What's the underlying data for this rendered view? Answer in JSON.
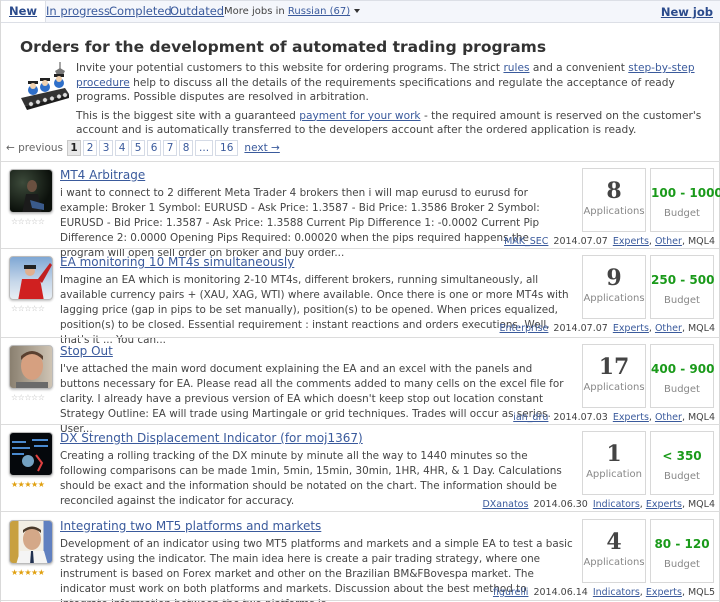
{
  "tabs": [
    {
      "label": "New",
      "active": true
    },
    {
      "label": "In progress",
      "active": false
    },
    {
      "label": "Completed",
      "active": false
    },
    {
      "label": "Outdated",
      "active": false
    }
  ],
  "more_jobs": {
    "prefix": "More jobs in ",
    "link": "Russian (67)"
  },
  "new_job_label": "New job",
  "intro": {
    "title": "Orders for the development of automated trading programs",
    "p1_a": "Invite your potential customers to this website for ordering programs. The strict ",
    "p1_link1": "rules",
    "p1_b": " and a convenient ",
    "p1_link2": "step-by-step procedure",
    "p1_c": " help to discuss all the details of the requirements specifications and regulate the acceptance of ready programs. Possible disputes are resolved in arbitration.",
    "p2_a": "This is the biggest site with a guaranteed ",
    "p2_link": "payment for your work",
    "p2_b": " - the required amount is reserved on the customer's account and is automatically transferred to the developers account after the ordered application is ready.",
    "icon": "robot-assembly-line-icon"
  },
  "pagination": {
    "prev": "← previous",
    "next": "next →",
    "pages": [
      "1",
      "2",
      "3",
      "4",
      "5",
      "6",
      "7",
      "8",
      "...",
      "16"
    ],
    "current": "1"
  },
  "jobs": [
    {
      "title": "MT4 Arbitrage",
      "description": "i want to connect to 2 different Meta Trader 4 brokers then  i will map eurusd to eurusd for example: Broker 1 Symbol: EURUSD - Ask Price: 1.3587 - Bid Price: 1.3586 Broker 2 Symbol: EURUSD - Bid Price: 1.3587 - Ask Price: 1.3588 Current Pip Difference 1: -0.0002 Current Pip Difference 2: 0.0000 Opening Pips Required: 0.00020 when the pips required happens the program will open sell order on broker and buy order...",
      "applications": "8",
      "applications_label": "Applications",
      "budget": "100 - 1000",
      "budget_label": "Budget",
      "author": "MAK_SEC",
      "date": "2014.07.07",
      "categories": [
        "Experts",
        "Other"
      ],
      "platform": "MQL4",
      "rating_stars": "☆☆☆☆☆",
      "rated": false
    },
    {
      "title": "EA monitoring 10 MT4s simultaneously",
      "description": "Imagine an EA which is monitoring 2-10 MT4s, different brokers, running simultaneously, all available currency pairs + (XAU, XAG, WTI) where available.  Once there is one or more MT4s with lagging price (gap in pips to be set manually), position(s) to be opened. When prices equalized, position(s) to be closed.  Essential requirement : instant reactions and orders executions. Well, that's it ... You can...",
      "applications": "9",
      "applications_label": "Applications",
      "budget": "250 - 500",
      "budget_label": "Budget",
      "author": "Enterprise",
      "date": "2014.07.07",
      "categories": [
        "Experts",
        "Other"
      ],
      "platform": "MQL4",
      "rating_stars": "☆☆☆☆☆",
      "rated": false
    },
    {
      "title": "Stop Out",
      "description": "I've attached the main word document explaining the EA and an excel with the panels and buttons necessary for EA.  Please read all the comments added to many cells on the excel file for clarity. I already have a previous version of EA which doesn't keep stop out location constant   Strategy Outline: EA will trade using Martingale or grid techniques.   Trades will occur as series.   User...",
      "applications": "17",
      "applications_label": "Applications",
      "budget": "400 - 900",
      "budget_label": "Budget",
      "author": "ian_dru",
      "date": "2014.07.03",
      "categories": [
        "Experts",
        "Other"
      ],
      "platform": "MQL4",
      "rating_stars": "☆☆☆☆☆",
      "rated": false
    },
    {
      "title": "DX Strength Displacement Indicator (for moj1367)",
      "description": "Creating a rolling tracking of the DX minute by minute all the way to 1440 minutes so the following comparisons can be made 1min, 5min, 15min, 30min, 1HR, 4HR, & 1 Day.  Calculations should be exact and the information should be notated on the chart.  The information should be reconciled against the indicator for accuracy.",
      "applications": "1",
      "applications_label": "Application",
      "budget": "< 350",
      "budget_label": "Budget",
      "author": "DXanatos",
      "date": "2014.06.30",
      "categories": [
        "Indicators",
        "Experts"
      ],
      "platform": "MQL4",
      "rating_stars": "★★★★★",
      "rated": true
    },
    {
      "title": "Integrating two MT5 platforms and markets",
      "description": "Development of an indicator using two MT5 platforms and markets and a simple EA to test a basic strategy using the indicator. The main idea here is create a pair trading strategy, where one instrument is based on Forex market and other on the Brazilian BM&FBovespa market. The indicator must work on both platforms and markets. Discussion about the best method to integrate information between the two platforms is...",
      "applications": "4",
      "applications_label": "Applications",
      "budget": "80 - 120",
      "budget_label": "Budget",
      "author": "figurelli",
      "date": "2014.06.14",
      "categories": [
        "Indicators",
        "Experts"
      ],
      "platform": "MQL5",
      "rating_stars": "★★★★★",
      "rated": true
    }
  ],
  "colors": {
    "link": "#3a5a9c",
    "budget_green": "#1a9a1a",
    "tabbar_bg": "#f4f6fb",
    "star_gold": "#e0a010"
  }
}
